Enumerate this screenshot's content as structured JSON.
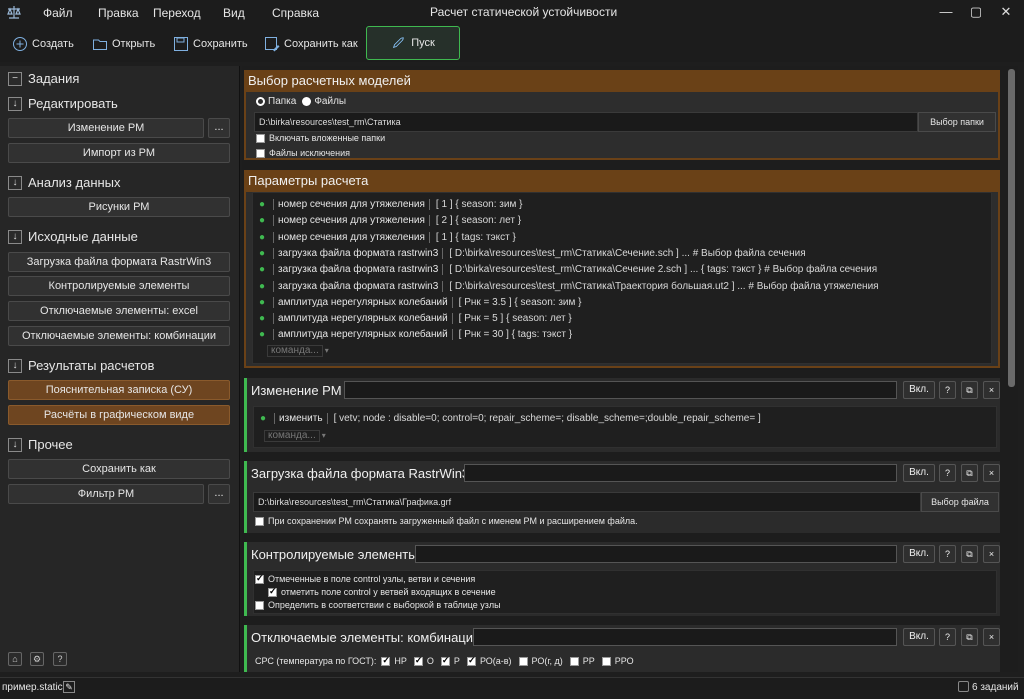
{
  "menu": {
    "file": "Файл",
    "edit": "Правка",
    "go": "Переход",
    "view": "Вид",
    "help": "Справка"
  },
  "window": {
    "title": "Расчет статической устойчивости",
    "min": "—",
    "max": "▢",
    "close": "✕"
  },
  "toolbar": {
    "create": "Создать",
    "open": "Открыть",
    "save": "Сохранить",
    "save_as": "Сохранить как",
    "run": "Пуск"
  },
  "sidebar": {
    "tasks": "Задания",
    "tasks_marker": "−",
    "edit_title": "Редактировать",
    "change_rm": "Изменение РМ",
    "dots": "...",
    "import_rm": "Импорт из РМ",
    "analysis_title": "Анализ данных",
    "pictures_rm": "Рисунки РМ",
    "source_title": "Исходные данные",
    "load_rastr": "Загрузка файла формата RastrWin3",
    "controlled": "Контролируемые элементы",
    "off_excel": "Отключаемые элементы: excel",
    "off_comb": "Отключаемые элементы: комбинации",
    "results_title": "Результаты расчетов",
    "note": "Пояснительная записка (СУ)",
    "graph": "Расчёты в графическом виде",
    "other_title": "Прочее",
    "save_as": "Сохранить как",
    "filter_rm": "Фильтр РМ",
    "arrow": "↓",
    "bottom_home": "⌂",
    "bottom_gear": "⚙",
    "bottom_help": "?"
  },
  "models": {
    "title": "Выбор расчетных моделей",
    "folder": "Папка",
    "files": "Файлы",
    "path": "D:\\birka\\resources\\test_rm\\Статика",
    "choose_folder": "Выбор папки",
    "include_sub": "Включать вложенные папки",
    "exclude_files": "Файлы исключения"
  },
  "params": {
    "title": "Параметры расчета",
    "placeholder": "команда...",
    "rows": [
      {
        "kw": "номер сечения для утяжеления",
        "arg": "[ 1         ]  { season: зим }"
      },
      {
        "kw": "номер сечения для утяжеления",
        "arg": "[ 2         ]  { season: лет }"
      },
      {
        "kw": "номер сечения для утяжеления",
        "arg": "[ 1         ]  { tags: тэкст }"
      },
      {
        "kw": "загрузка файла формата rastrwin3",
        "arg": "[ D:\\birka\\resources\\test_rm\\Статика\\Сечение.sch ]  ...  # Выбор файла сечения"
      },
      {
        "kw": "загрузка файла формата rastrwin3",
        "arg": "[ D:\\birka\\resources\\test_rm\\Статика\\Сечение 2.sch ]  ...  { tags: тэкст } # Выбор файла сечения"
      },
      {
        "kw": "загрузка файла формата rastrwin3",
        "arg": "[ D:\\birka\\resources\\test_rm\\Статика\\Траектория большая.ut2 ]  ...   # Выбор файла утяжеления"
      },
      {
        "kw": "амплитуда нерегулярных колебаний",
        "arg": "[ Рнк = 3.5 ]  { season: зим }"
      },
      {
        "kw": "амплитуда нерегулярных колебаний",
        "arg": "[ Рнк = 5 ]  { season: лет }"
      },
      {
        "kw": "амплитуда нерегулярных колебаний",
        "arg": "[ Рнк = 30 ]  { tags: тэкст }"
      }
    ]
  },
  "panel_common": {
    "on": "Вкл.",
    "help": "?",
    "copy": "⧉",
    "close": "×"
  },
  "change_rm": {
    "title": "Изменение РМ",
    "kw": "изменить",
    "arg": "[ vetv; node  :  disable=0; control=0; repair_scheme=; disable_scheme=;double_repair_scheme= ]",
    "placeholder": "команда..."
  },
  "load_rastr": {
    "title": "Загрузка файла формата RastrWin3",
    "path": "D:\\birka\\resources\\test_rm\\Статика\\Графика.grf",
    "choose_file": "Выбор файла",
    "save_note": "При сохранении РМ сохранять загруженный файл с именем РМ и расширением файла."
  },
  "controlled": {
    "title": "Контролируемые элементы",
    "marked": "Отмеченные в поле control узлы, ветви и сечения",
    "mark_incoming": "отметить поле control у ветвей входящих в сечение",
    "by_selection": "Определить в соответствии с выборкой в таблице узлы"
  },
  "combos": {
    "title": "Отключаемые элементы: комбинации",
    "label": "СРС (температура по ГОСТ):",
    "opts": [
      {
        "t": "НР",
        "on": true
      },
      {
        "t": "О",
        "on": true
      },
      {
        "t": "Р",
        "on": true
      },
      {
        "t": "РО(а-в)",
        "on": true
      },
      {
        "t": "РО(г, д)",
        "on": false
      },
      {
        "t": "РР",
        "on": false
      },
      {
        "t": "РРО",
        "on": false
      }
    ]
  },
  "status": {
    "file": "пример.static",
    "tasks": "6 заданий"
  }
}
